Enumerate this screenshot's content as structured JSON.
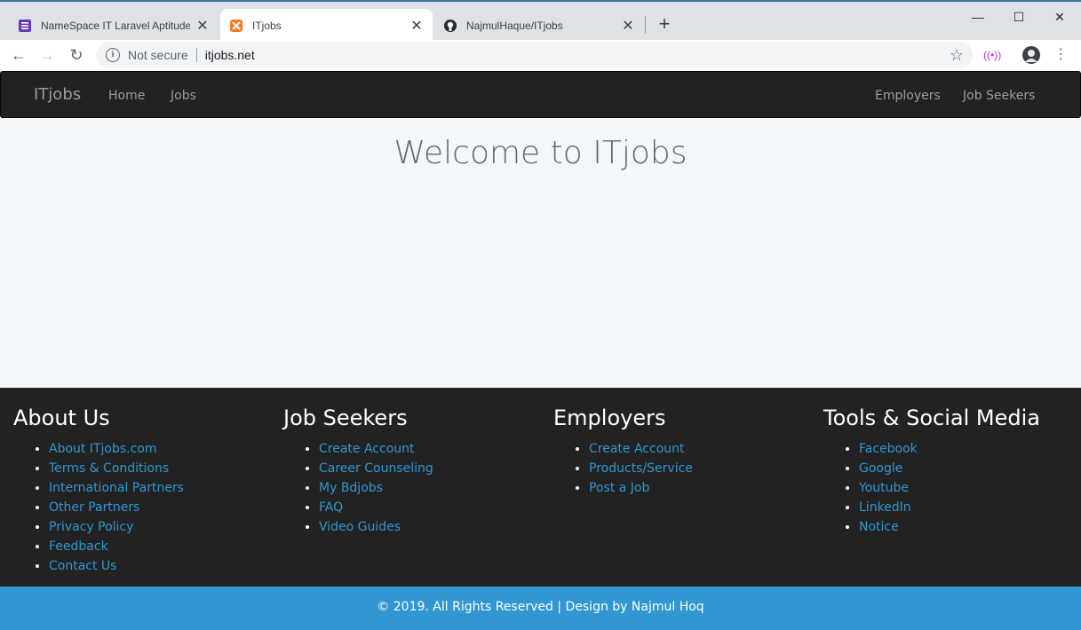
{
  "browser": {
    "tabs": [
      {
        "title": "NameSpace IT Laravel Aptitude T",
        "icon": "form-icon",
        "color": "#673ab7"
      },
      {
        "title": "ITjobs",
        "icon": "xampp-icon",
        "color": "#fb7a24"
      },
      {
        "title": "NajmulHaque/ITjobs",
        "icon": "github-icon",
        "color": "#24292e"
      }
    ],
    "security_label": "Not secure",
    "url": "itjobs.net"
  },
  "navbar": {
    "brand": "ITjobs",
    "left_links": [
      "Home",
      "Jobs"
    ],
    "right_links": [
      "Employers",
      "Job Seekers"
    ]
  },
  "main": {
    "heading": "Welcome to ITjobs"
  },
  "footer": {
    "columns": [
      {
        "title": "About Us",
        "links": [
          "About ITjobs.com",
          "Terms & Conditions",
          "International Partners",
          "Other Partners",
          "Privacy Policy",
          "Feedback",
          "Contact Us"
        ]
      },
      {
        "title": "Job Seekers",
        "links": [
          "Create Account",
          "Career Counseling",
          "My Bdjobs",
          "FAQ",
          "Video Guides"
        ]
      },
      {
        "title": "Employers",
        "links": [
          "Create Account",
          "Products/Service",
          "Post a Job"
        ]
      },
      {
        "title": "Tools & Social Media",
        "links": [
          "Facebook",
          "Google",
          "Youtube",
          "LinkedIn",
          "Notice"
        ]
      }
    ],
    "copyright": "© 2019. All Rights Reserved | Design by Najmul Hoq"
  },
  "colors": {
    "navbar_bg": "#222222",
    "link": "#3097d1",
    "copyright_bg": "#3097d1",
    "page_bg": "#f4f7f9"
  }
}
